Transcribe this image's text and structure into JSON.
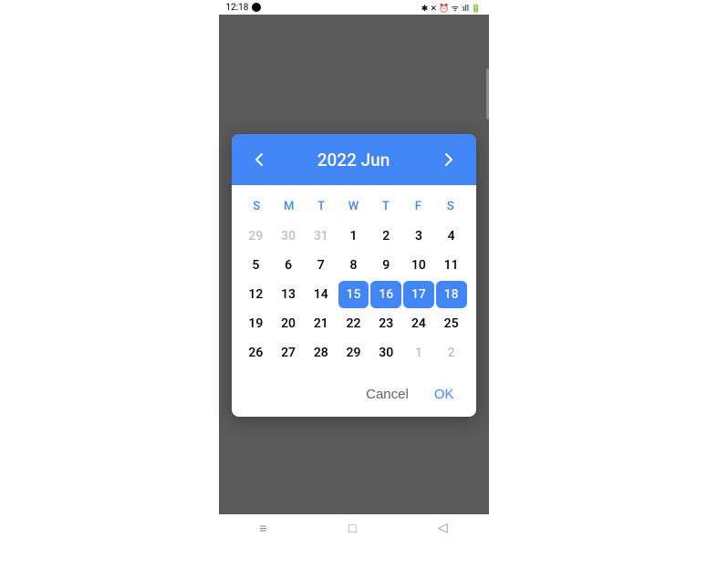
{
  "status_bar": {
    "time": "12:18",
    "icons": "✱ ✕ ⏰ ᯤ ⫶ıll 🔋"
  },
  "picker": {
    "header_title": "2022 Jun",
    "weekdays": [
      "S",
      "M",
      "T",
      "W",
      "T",
      "F",
      "S"
    ],
    "days": [
      {
        "d": "29",
        "type": "other-month",
        "selected": false
      },
      {
        "d": "30",
        "type": "other-month",
        "selected": false
      },
      {
        "d": "31",
        "type": "other-month",
        "selected": false
      },
      {
        "d": "1",
        "type": "current-month",
        "selected": false
      },
      {
        "d": "2",
        "type": "current-month",
        "selected": false
      },
      {
        "d": "3",
        "type": "current-month",
        "selected": false
      },
      {
        "d": "4",
        "type": "current-month",
        "selected": false
      },
      {
        "d": "5",
        "type": "current-month",
        "selected": false
      },
      {
        "d": "6",
        "type": "current-month",
        "selected": false
      },
      {
        "d": "7",
        "type": "current-month",
        "selected": false
      },
      {
        "d": "8",
        "type": "current-month",
        "selected": false
      },
      {
        "d": "9",
        "type": "current-month",
        "selected": false
      },
      {
        "d": "10",
        "type": "current-month",
        "selected": false
      },
      {
        "d": "11",
        "type": "current-month",
        "selected": false
      },
      {
        "d": "12",
        "type": "current-month",
        "selected": false
      },
      {
        "d": "13",
        "type": "current-month",
        "selected": false
      },
      {
        "d": "14",
        "type": "current-month",
        "selected": false
      },
      {
        "d": "15",
        "type": "current-month",
        "selected": true
      },
      {
        "d": "16",
        "type": "current-month",
        "selected": true
      },
      {
        "d": "17",
        "type": "current-month",
        "selected": true
      },
      {
        "d": "18",
        "type": "current-month",
        "selected": true
      },
      {
        "d": "19",
        "type": "current-month",
        "selected": false
      },
      {
        "d": "20",
        "type": "current-month",
        "selected": false
      },
      {
        "d": "21",
        "type": "current-month",
        "selected": false
      },
      {
        "d": "22",
        "type": "current-month",
        "selected": false
      },
      {
        "d": "23",
        "type": "current-month",
        "selected": false
      },
      {
        "d": "24",
        "type": "current-month",
        "selected": false
      },
      {
        "d": "25",
        "type": "current-month",
        "selected": false
      },
      {
        "d": "26",
        "type": "current-month",
        "selected": false
      },
      {
        "d": "27",
        "type": "current-month",
        "selected": false
      },
      {
        "d": "28",
        "type": "current-month",
        "selected": false
      },
      {
        "d": "29",
        "type": "current-month",
        "selected": false
      },
      {
        "d": "30",
        "type": "current-month",
        "selected": false
      },
      {
        "d": "1",
        "type": "other-month",
        "selected": false
      },
      {
        "d": "2",
        "type": "other-month",
        "selected": false
      }
    ],
    "actions": {
      "cancel": "Cancel",
      "ok": "OK"
    }
  },
  "nav_bar": {
    "recent": "≡",
    "home": "□",
    "back": "◁"
  }
}
